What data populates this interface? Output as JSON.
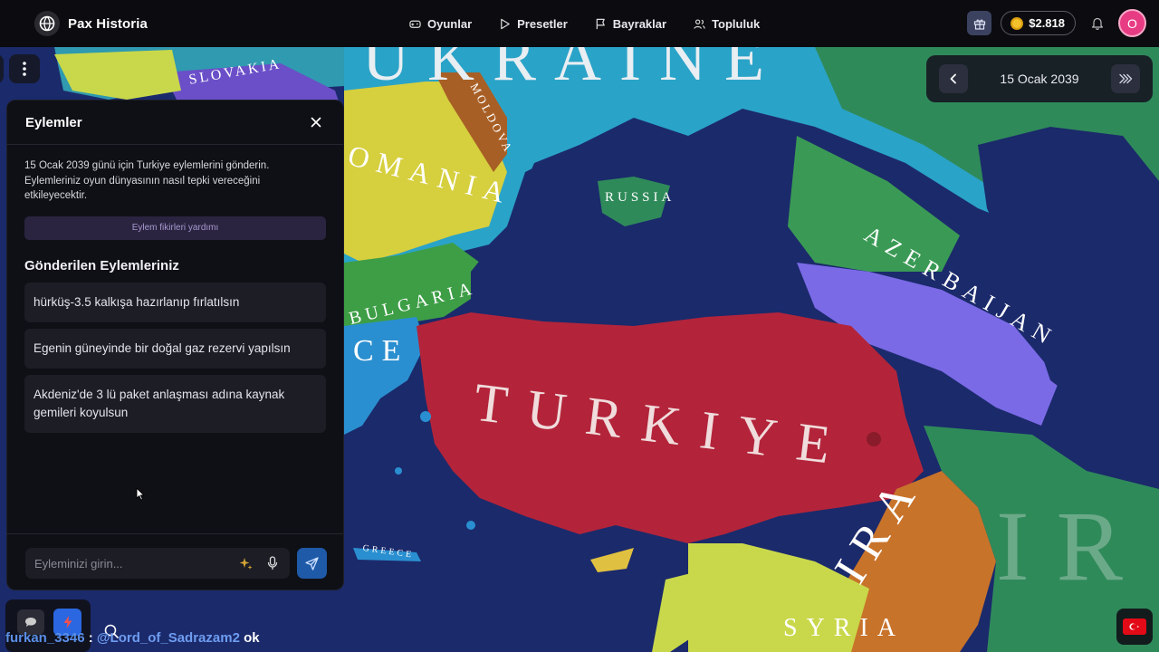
{
  "app": {
    "name": "Pax Historia"
  },
  "nav": {
    "items": [
      {
        "label": "Oyunlar",
        "icon": "gamepad-icon"
      },
      {
        "label": "Presetler",
        "icon": "play-icon"
      },
      {
        "label": "Bayraklar",
        "icon": "flag-icon"
      },
      {
        "label": "Topluluk",
        "icon": "users-icon"
      }
    ]
  },
  "toolbar": {
    "balance": "$2.818",
    "avatar_initial": "O"
  },
  "date_control": {
    "date": "15 Ocak 2039"
  },
  "map": {
    "labels": {
      "slovakia": "SLOVAKIA",
      "ukraine": "UKRAINE",
      "moldova": "MOLDOVA",
      "romania": "OMANIA",
      "russia": "RUSSIA",
      "bulgaria": "BULGARIA",
      "greece_partial": "CE",
      "greece": "GREECE",
      "turkiye": "TURKIYE",
      "azerbaijan": "AZERBAIJAN",
      "iran": "IRA",
      "syria": "SYRIA",
      "iraq_partial": "IR"
    }
  },
  "panel": {
    "title": "Eylemler",
    "description": "15 Ocak 2039 günü için Turkiye eylemlerini gönderin. Eylemleriniz oyun dünyasının nasıl tepki vereceğini etkileyecektir.",
    "ideas_button": "Eylem fikirleri yardımı",
    "submitted_title": "Gönderilen Eylemleriniz",
    "actions": [
      "hürküş-3.5 kalkışa hazırlanıp fırlatılsın",
      "Egenin güneyinde bir doğal gaz rezervi yapılsın",
      "Akdeniz'de 3 lü paket anlaşması adına kaynak gemileri koyulsun"
    ],
    "input_placeholder": "Eyleminizi girin..."
  },
  "chat": {
    "user": "furkan_3346",
    "separator": ":",
    "mention": "@Lord_of_Sadrazam2",
    "message": "ok"
  },
  "colors": {
    "turkiye": "#b3243a",
    "sea": "#1b2a6b",
    "send_button": "#1e5aa8",
    "avatar": "#e73c84"
  }
}
